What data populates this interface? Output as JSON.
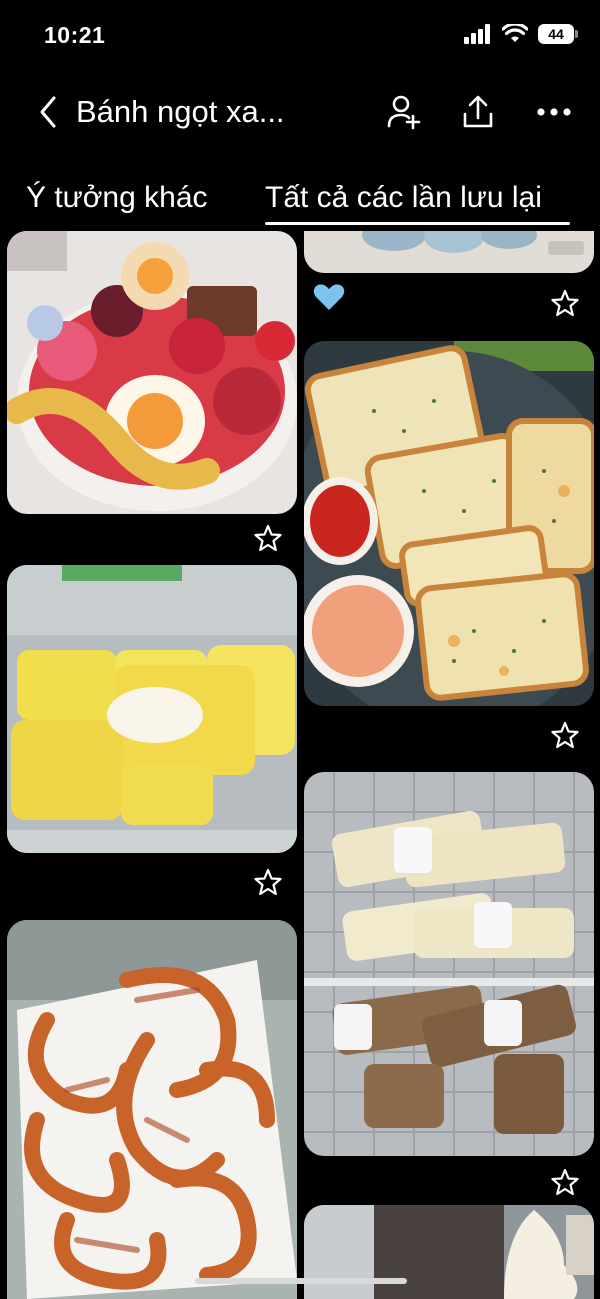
{
  "status_bar": {
    "time": "10:21",
    "battery": "44"
  },
  "header": {
    "title": "Bánh ngọt xa..."
  },
  "tabs": [
    {
      "label": "Ý tưởng khác",
      "active": false
    },
    {
      "label": "Tất cả các lần lưu lại",
      "active": true
    }
  ],
  "pins": [
    {
      "subject": "gummy candy cup",
      "saved": false
    },
    {
      "subject": "top partial pin",
      "saved": false,
      "reaction": "blue-heart"
    },
    {
      "subject": "garlic bread with dipping sauces",
      "saved": false
    },
    {
      "subject": "durian crepes in container",
      "saved": false
    },
    {
      "subject": "ice cream cones in freezer",
      "saved": false
    },
    {
      "subject": "curly fries",
      "saved": false
    },
    {
      "subject": "soft serve ice cream",
      "saved": false
    }
  ],
  "colors": {
    "background": "#000000",
    "text": "#ffffff",
    "heart": "#7cc4f0"
  }
}
